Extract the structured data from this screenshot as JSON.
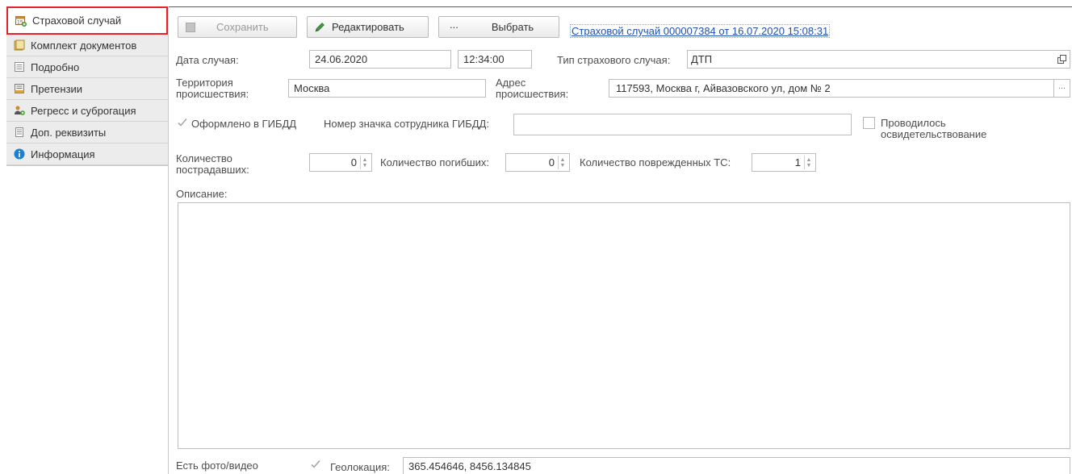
{
  "sidebar": {
    "items": [
      {
        "label": "Страховой случай",
        "icon": "calendar-add-icon",
        "active": true
      },
      {
        "label": "Комплект документов",
        "icon": "documents-icon",
        "active": false
      },
      {
        "label": "Подробно",
        "icon": "details-icon",
        "active": false
      },
      {
        "label": "Претензии",
        "icon": "claims-icon",
        "active": false
      },
      {
        "label": "Регресс и суброгация",
        "icon": "users-icon",
        "active": false
      },
      {
        "label": "Доп. реквизиты",
        "icon": "list-icon",
        "active": false
      },
      {
        "label": "Информация",
        "icon": "info-icon",
        "active": false
      }
    ]
  },
  "toolbar": {
    "save_label": "Сохранить",
    "edit_label": "Редактировать",
    "select_dots": "...",
    "select_label": "Выбрать",
    "doc_link": "Страховой случай 000007384 от 16.07.2020 15:08:31"
  },
  "form": {
    "date_label": "Дата случая:",
    "date_value": "24.06.2020",
    "time_value": "12:34:00",
    "type_label": "Тип страхового случая:",
    "type_value": "ДТП",
    "territory_label": "Территория происшествия:",
    "territory_value": "Москва",
    "address_label": "Адрес происшествия:",
    "address_value": "117593, Москва г, Айвазовского ул, дом № 2",
    "address_select": "...",
    "gibdd_label": "Оформлено в ГИБДД",
    "gibdd_checked": true,
    "badge_label": "Номер значка сотрудника ГИБДД:",
    "badge_value": "",
    "exam_label": "Проводилось освидетельствование",
    "exam_checked": false,
    "victims_label": "Количество пострадавших:",
    "victims_value": "0",
    "dead_label": "Количество погибших:",
    "dead_value": "0",
    "damaged_label": "Количество поврежденных ТС:",
    "damaged_value": "1",
    "description_label": "Описание:",
    "description_value": "",
    "photo_label": "Есть фото/видео",
    "photo_checked": true,
    "geo_label": "Геолокация:",
    "geo_value": "365.454646, 8456.134845"
  },
  "colors": {
    "active_border": "#e8202a",
    "link": "#1f4fb0",
    "sidebar_bg": "#ececec"
  }
}
